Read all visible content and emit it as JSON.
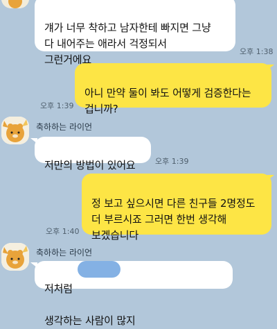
{
  "chat": {
    "contact_name": "축하하는 라이언",
    "messages": [
      {
        "side": "in",
        "text": "걔가 너무 착하고 남자한테 빠지면 그냥\n다 내어주는 애라서 걱정되서\n그런거에요",
        "time": "오후 1:38"
      },
      {
        "side": "out",
        "text": "아니 만약 둘이 봐도 어떻게 검증한다는\n겁니까?",
        "time": "오후 1:39"
      },
      {
        "side": "in",
        "text": "저만의 방법이 있어요",
        "time": "오후 1:39"
      },
      {
        "side": "out",
        "text": "정 보고 싶으시면 다른 친구들 2명정도\n더 부르시죠 그러면 한번 생각해\n보겠습니다",
        "time": "오후 1:40"
      },
      {
        "side": "in",
        "text_before": "저처럼",
        "text_after": "생각하는 사람이 많지"
      }
    ]
  },
  "colors": {
    "background": "#b2c7da",
    "incoming_bubble": "#ffffff",
    "outgoing_bubble": "#fde545",
    "redaction": "#6ea3df"
  }
}
